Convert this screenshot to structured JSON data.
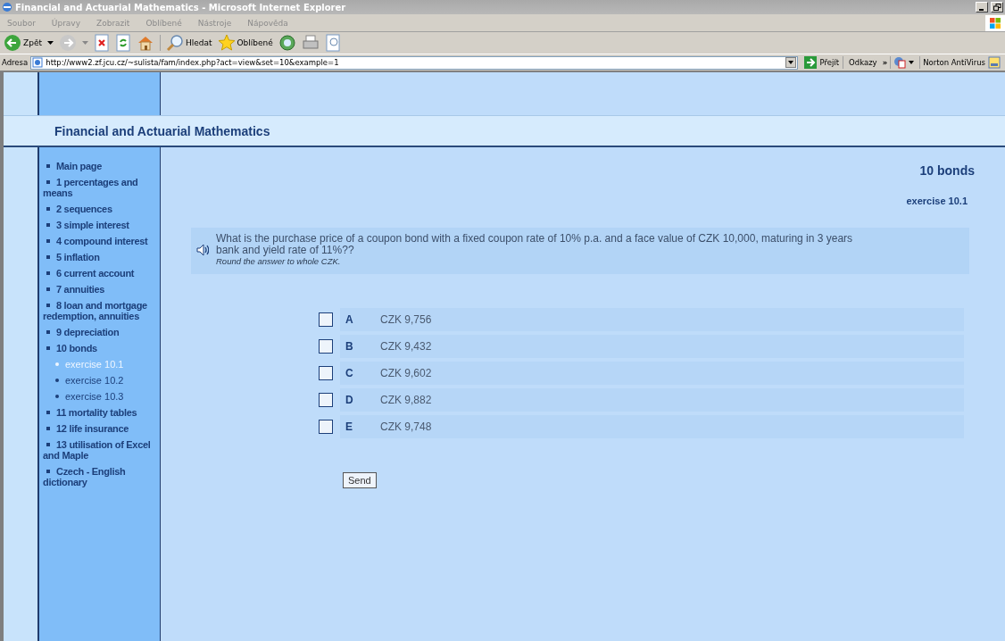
{
  "window": {
    "title": "Financial and Actuarial Mathematics - Microsoft Internet Explorer"
  },
  "menu": [
    "Soubor",
    "Úpravy",
    "Zobrazit",
    "Oblíbené",
    "Nástroje",
    "Nápověda"
  ],
  "toolbar": {
    "back": "Zpět",
    "search": "Hledat",
    "favorites": "Oblíbené"
  },
  "address_bar": {
    "label": "Adresa",
    "value": "http://www2.zf.jcu.cz/~sulista/fam/index.php?act=view&set=10&example=1",
    "go": "Přejít",
    "links": "Odkazy",
    "links_more": "»",
    "norton": "Norton AntiVirus"
  },
  "site_title": "Financial and Actuarial Mathematics",
  "sidebar": {
    "items": [
      {
        "label": "Main page"
      },
      {
        "label": "1 percentages and means"
      },
      {
        "label": "2 sequences"
      },
      {
        "label": "3 simple interest"
      },
      {
        "label": "4 compound interest"
      },
      {
        "label": "5 inflation"
      },
      {
        "label": "6 current account"
      },
      {
        "label": "7 annuities"
      },
      {
        "label": "8 loan and mortgage redemption, annuities"
      },
      {
        "label": "9 depreciation"
      },
      {
        "label": "10 bonds",
        "children": [
          {
            "label": "exercise 10.1",
            "selected": true
          },
          {
            "label": "exercise 10.2",
            "selected": false
          },
          {
            "label": "exercise 10.3",
            "selected": false
          }
        ]
      },
      {
        "label": "11 mortality tables"
      },
      {
        "label": "12 life insurance"
      },
      {
        "label": "13 utilisation of Excel and Maple"
      },
      {
        "label": "Czech - English dictionary"
      }
    ]
  },
  "heading": "10 bonds",
  "subheading": "exercise 10.1",
  "question": {
    "text": "What is the purchase price of a coupon bond with a fixed coupon rate of 10% p.a. and a face value of CZK 10,000, maturing in 3 years bank and yield rate of 11%??",
    "hint": "Round the answer to whole CZK."
  },
  "options": [
    {
      "letter": "A",
      "text": "CZK 9,756",
      "selected": false
    },
    {
      "letter": "B",
      "text": "CZK 9,432",
      "selected": false
    },
    {
      "letter": "C",
      "text": "CZK 9,602",
      "selected": false
    },
    {
      "letter": "D",
      "text": "CZK 9,882",
      "selected": false
    },
    {
      "letter": "E",
      "text": "CZK 9,748",
      "selected": false
    }
  ],
  "send_button": "Send"
}
